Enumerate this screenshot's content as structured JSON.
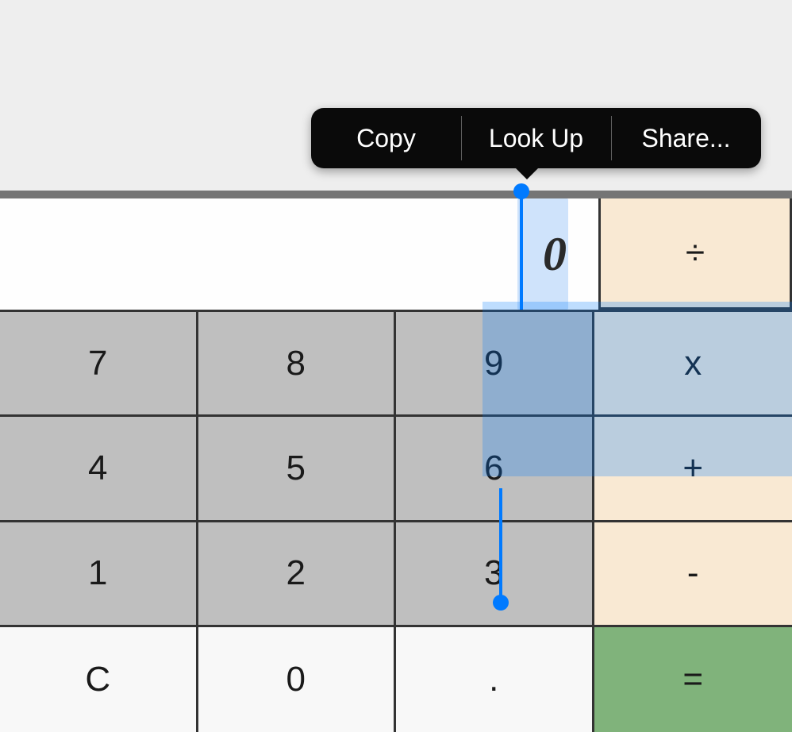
{
  "display": {
    "value": "0"
  },
  "contextMenu": {
    "copy": "Copy",
    "lookup": "Look Up",
    "share": "Share..."
  },
  "keys": {
    "divide": "÷",
    "multiply": "x",
    "plus": "+",
    "minus": "-",
    "equals": "=",
    "seven": "7",
    "eight": "8",
    "nine": "9",
    "four": "4",
    "five": "5",
    "six": "6",
    "one": "1",
    "two": "2",
    "three": "3",
    "clear": "C",
    "zero": "0",
    "decimal": "."
  }
}
